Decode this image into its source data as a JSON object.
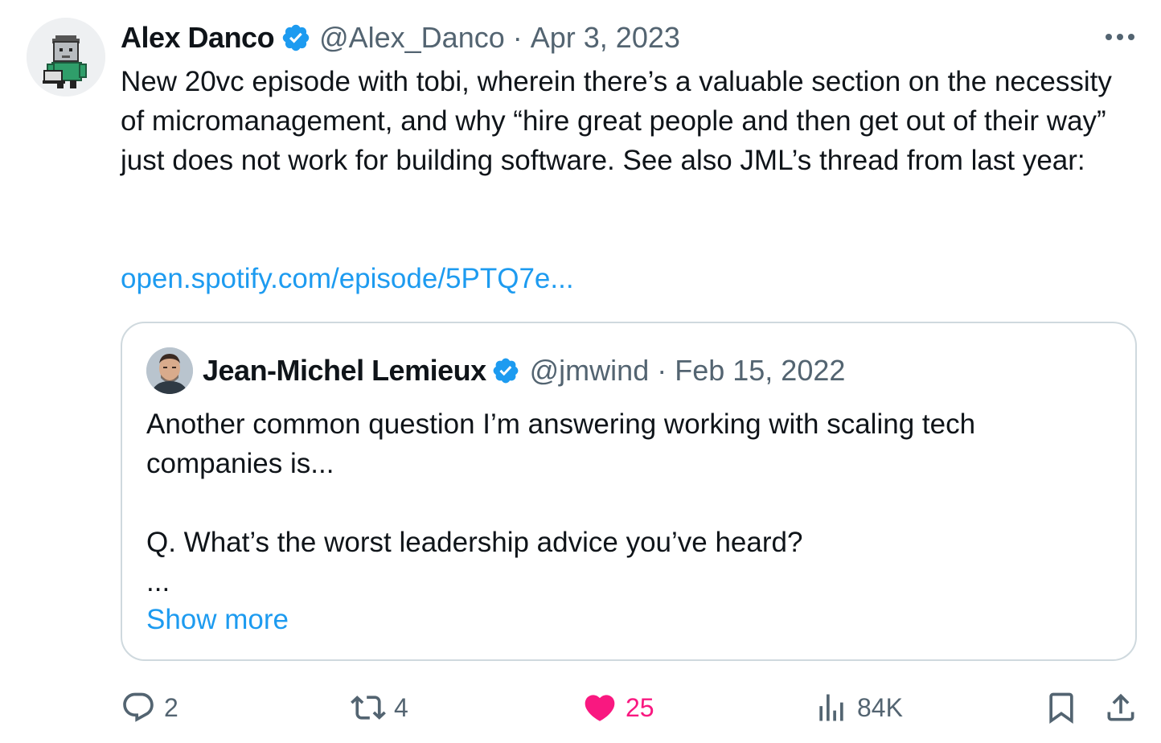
{
  "tweet": {
    "author_name": "Alex Danco",
    "author_handle": "@Alex_Danco",
    "separator": "·",
    "date": "Apr 3, 2023",
    "text": "New 20vc episode with tobi, wherein there’s a valuable section on the necessity of micromanagement, and why “hire great people and then get out of their way” just does not work for building software. See also JML’s thread from last year:",
    "link": "open.spotify.com/episode/5PTQ7e..."
  },
  "quoted": {
    "author_name": "Jean-Michel Lemieux",
    "author_handle": "@jmwind",
    "separator": "·",
    "date": "Feb 15, 2022",
    "text": "Another common question I’m answering working with scaling tech companies is...\n\nQ. What’s the worst leadership advice you’ve heard?\n...",
    "show_more": "Show more"
  },
  "actions": {
    "replies": "2",
    "retweets": "4",
    "likes": "25",
    "views": "84K"
  },
  "colors": {
    "accent": "#1d9bf0",
    "muted": "#536471",
    "like": "#f91880",
    "border": "#cfd9de"
  },
  "icons": {
    "verified": "verified-badge-icon",
    "more": "more-horizontal-icon",
    "reply": "reply-icon",
    "retweet": "retweet-icon",
    "like": "heart-filled-icon",
    "views": "views-icon",
    "bookmark": "bookmark-icon",
    "share": "share-icon"
  }
}
